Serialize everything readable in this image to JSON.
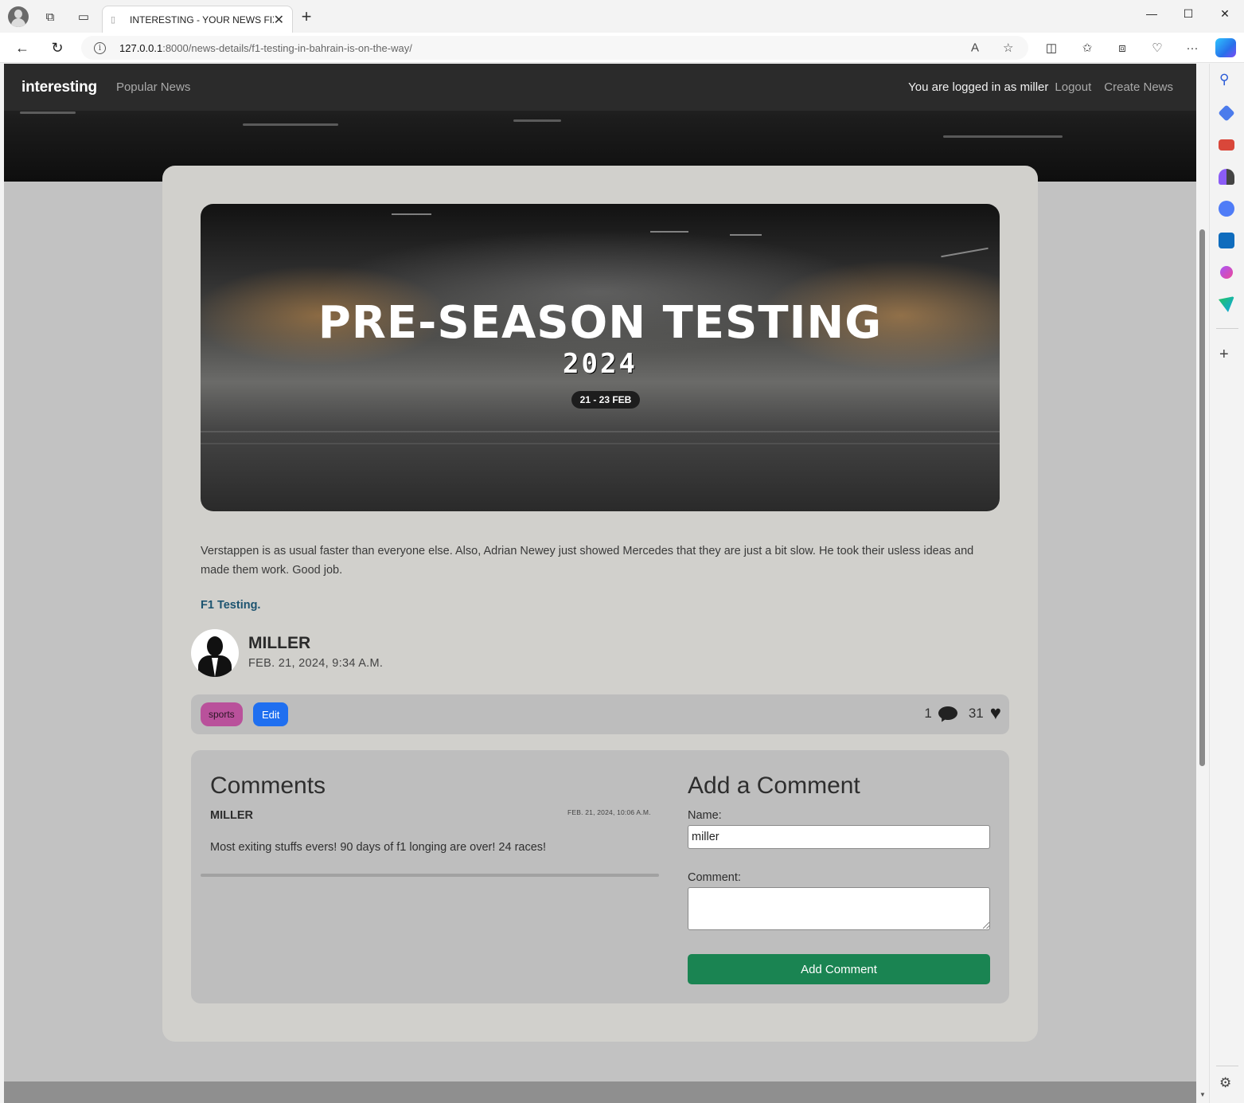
{
  "browser": {
    "tab_title": "INTERESTING - YOUR NEWS FIX",
    "url_host": "127.0.0.1",
    "url_path": ":8000/news-details/f1-testing-in-bahrain-is-on-the-way/"
  },
  "navbar": {
    "brand": "interesting",
    "popular": "Popular News",
    "logged_in": "You are logged in as miller",
    "logout": "Logout",
    "create": "Create News"
  },
  "article": {
    "banner_title": "PRE-SEASON TESTING",
    "banner_year": "2024",
    "banner_dates": "21 - 23 FEB",
    "body": "Verstappen is as usual faster than everyone else. Also, Adrian Newey just showed Mercedes that they are just a bit slow. He took their usless ideas and made them work. Good job.",
    "tagline": "F1 Testing.",
    "author": "MILLER",
    "date": "FEB. 21, 2024, 9:34 A.M.",
    "category": "sports",
    "edit_label": "Edit",
    "comment_count": "1",
    "like_count": "31"
  },
  "comments": {
    "title": "Comments",
    "items": [
      {
        "user": "MILLER",
        "date": "FEB. 21, 2024, 10:06 A.M.",
        "text": "Most exiting stuffs evers! 90 days of f1 longing are over! 24 races!"
      }
    ]
  },
  "add_comment": {
    "title": "Add a Comment",
    "name_label": "Name:",
    "name_value": "miller",
    "comment_label": "Comment:",
    "comment_value": "",
    "submit_label": "Add Comment"
  }
}
